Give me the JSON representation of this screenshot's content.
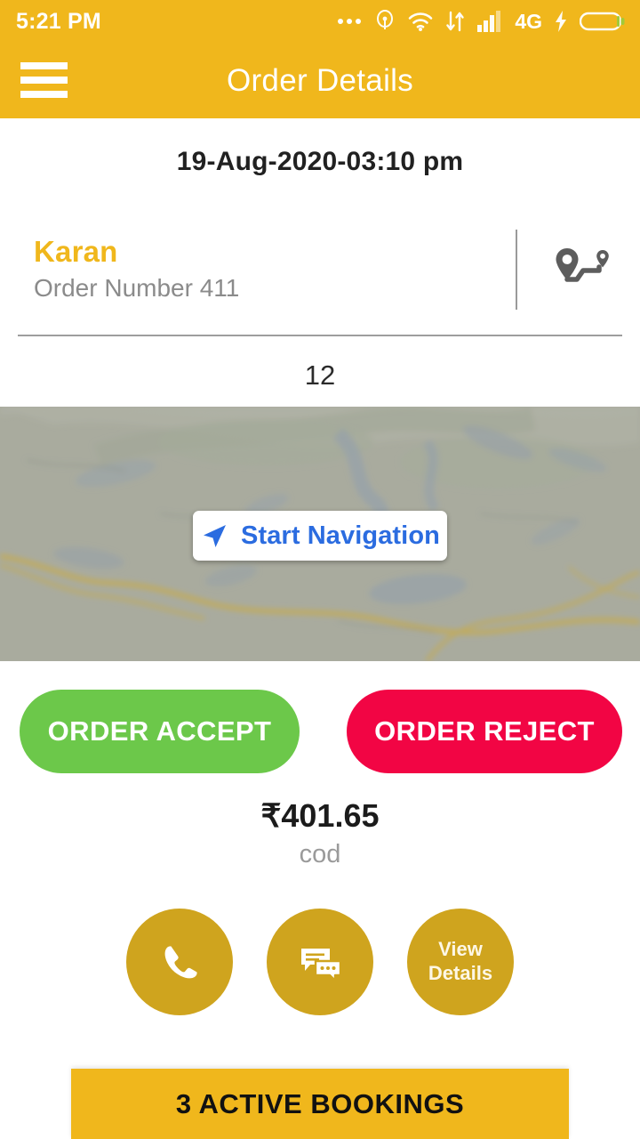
{
  "status_bar": {
    "time": "5:21 PM",
    "network_label": "4G",
    "icons": [
      "more-dots-icon",
      "location-icon",
      "wifi-icon",
      "data-transfer-icon",
      "signal-bars-icon",
      "charging-bolt-icon",
      "battery-icon"
    ]
  },
  "app_bar": {
    "title": "Order Details",
    "menu_icon": "hamburger-menu-icon"
  },
  "order": {
    "datetime": "19-Aug-2020-03:10 pm",
    "customer_name": "Karan",
    "order_number_label": "Order Number 411",
    "item_count": "12",
    "amount": "₹401.65",
    "payment_mode": "cod",
    "route_icon": "route-pins-icon"
  },
  "map": {
    "nav_button_label": "Start Navigation",
    "nav_icon": "navigation-arrow-icon"
  },
  "actions": {
    "accept_label": "ORDER ACCEPT",
    "reject_label": "ORDER REJECT",
    "call_icon": "phone-icon",
    "chat_icon": "chat-bubbles-icon",
    "view_details_line1": "View",
    "view_details_line2": "Details"
  },
  "bottom_bar": {
    "label": "3 ACTIVE BOOKINGS"
  },
  "colors": {
    "brand_yellow": "#F0B71C",
    "accept_green": "#6CC84A",
    "reject_red": "#F20544",
    "circle_gold": "#CFA41E",
    "nav_blue": "#2B6CE0",
    "muted_gray": "#8B8B8B"
  }
}
